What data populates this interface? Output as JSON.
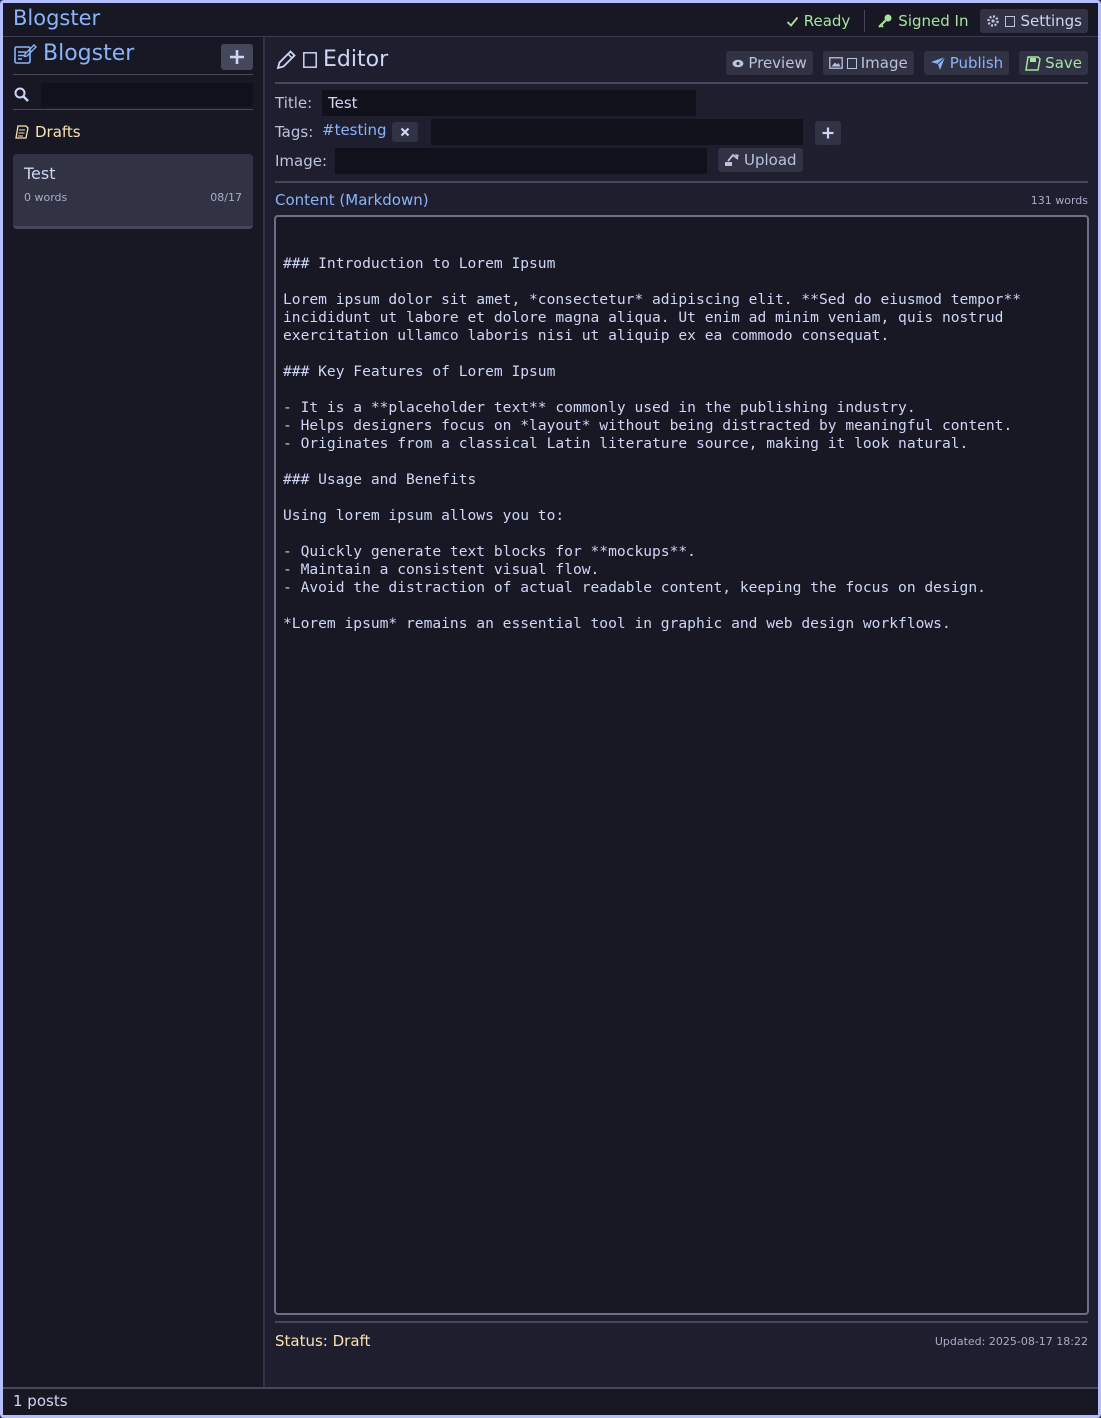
{
  "app": {
    "title": "Blogster"
  },
  "topbar": {
    "status": "Ready",
    "auth": "Signed In",
    "settings_label": "Settings"
  },
  "sidebar": {
    "brand": "Blogster",
    "add_icon": "plus-icon",
    "search": {
      "placeholder": "",
      "value": ""
    },
    "section_label": "Drafts",
    "posts": [
      {
        "title": "Test",
        "words": "0 words",
        "date": "08/17"
      }
    ]
  },
  "editor": {
    "heading": "Editor",
    "actions": {
      "preview": "Preview",
      "image": "Image",
      "publish": "Publish",
      "save": "Save"
    },
    "fields": {
      "title_label": "Title:",
      "title_value": "Test",
      "tags_label": "Tags:",
      "tags": [
        "#testing"
      ],
      "tag_input_value": "",
      "image_label": "Image:",
      "image_value": "",
      "upload_label": "Upload"
    },
    "content_label": "Content (Markdown)",
    "word_count": "131 words",
    "content": "### Introduction to Lorem Ipsum\n\nLorem ipsum dolor sit amet, *consectetur* adipiscing elit. **Sed do eiusmod tempor**\nincididunt ut labore et dolore magna aliqua. Ut enim ad minim veniam, quis nostrud\nexercitation ullamco laboris nisi ut aliquip ex ea commodo consequat.\n\n### Key Features of Lorem Ipsum\n\n- It is a **placeholder text** commonly used in the publishing industry.\n- Helps designers focus on *layout* without being distracted by meaningful content.\n- Originates from a classical Latin literature source, making it look natural.\n\n### Usage and Benefits\n\nUsing lorem ipsum allows you to:\n\n- Quickly generate text blocks for **mockups**.\n- Maintain a consistent visual flow.\n- Avoid the distraction of actual readable content, keeping the focus on design.\n\n*Lorem ipsum* remains an essential tool in graphic and web design workflows.",
    "status": "Status: Draft",
    "updated": "Updated: 2025-08-17 18:22"
  },
  "footer": {
    "post_count": "1 posts"
  },
  "colors": {
    "accent": "#89b4fa",
    "success": "#a6e3a1",
    "warning": "#f9e2af",
    "background": "#1e1e2e"
  }
}
